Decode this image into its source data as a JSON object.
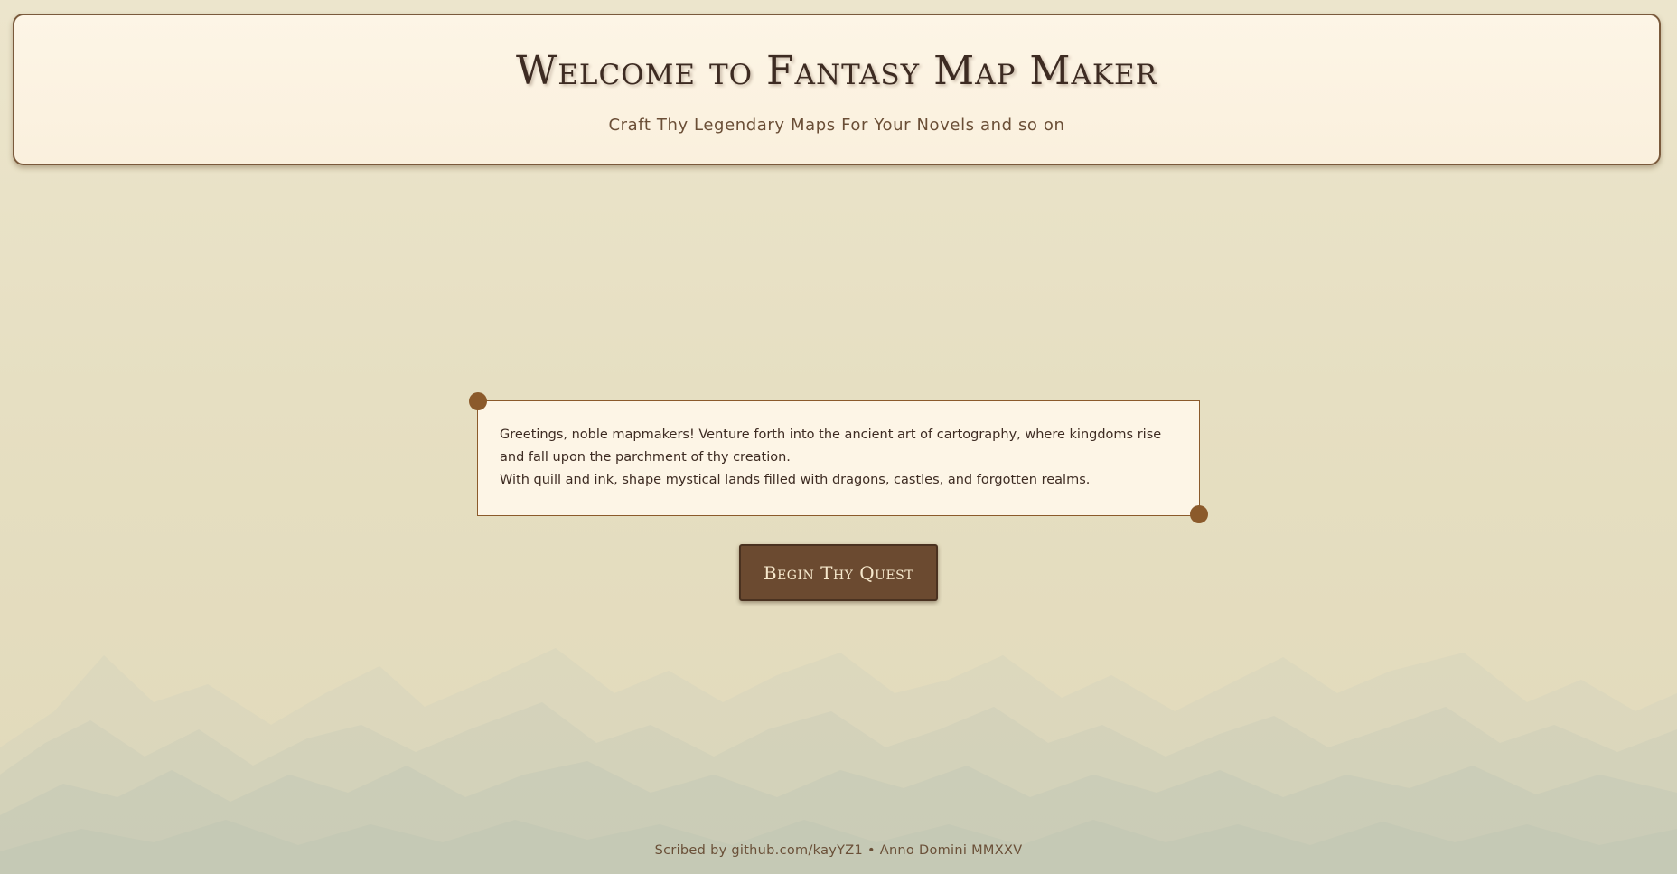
{
  "header": {
    "title": "Welcome to Fantasy Map Maker",
    "subtitle": "Craft Thy Legendary Maps For Your Novels and so on"
  },
  "intro": {
    "line1": "Greetings, noble mapmakers! Venture forth into the ancient art of cartography, where kingdoms rise and fall upon the parchment of thy creation.",
    "line2": "With quill and ink, shape mystical lands filled with dragons, castles, and forgotten realms."
  },
  "cta": {
    "label": "Begin Thy Quest"
  },
  "footer": {
    "text": "Scribed by github.com/kayYZ1 • Anno Domini MMXXV"
  },
  "theme": {
    "parchment": "#fdf5e6",
    "brown_accent": "#8b5a2b",
    "button_bg": "#6b4a30",
    "background": "#e6dfc2",
    "mountains": "#c8cbb8",
    "decoration_icons": [
      "corner-dot-icon",
      "mountain-range-icon"
    ]
  }
}
